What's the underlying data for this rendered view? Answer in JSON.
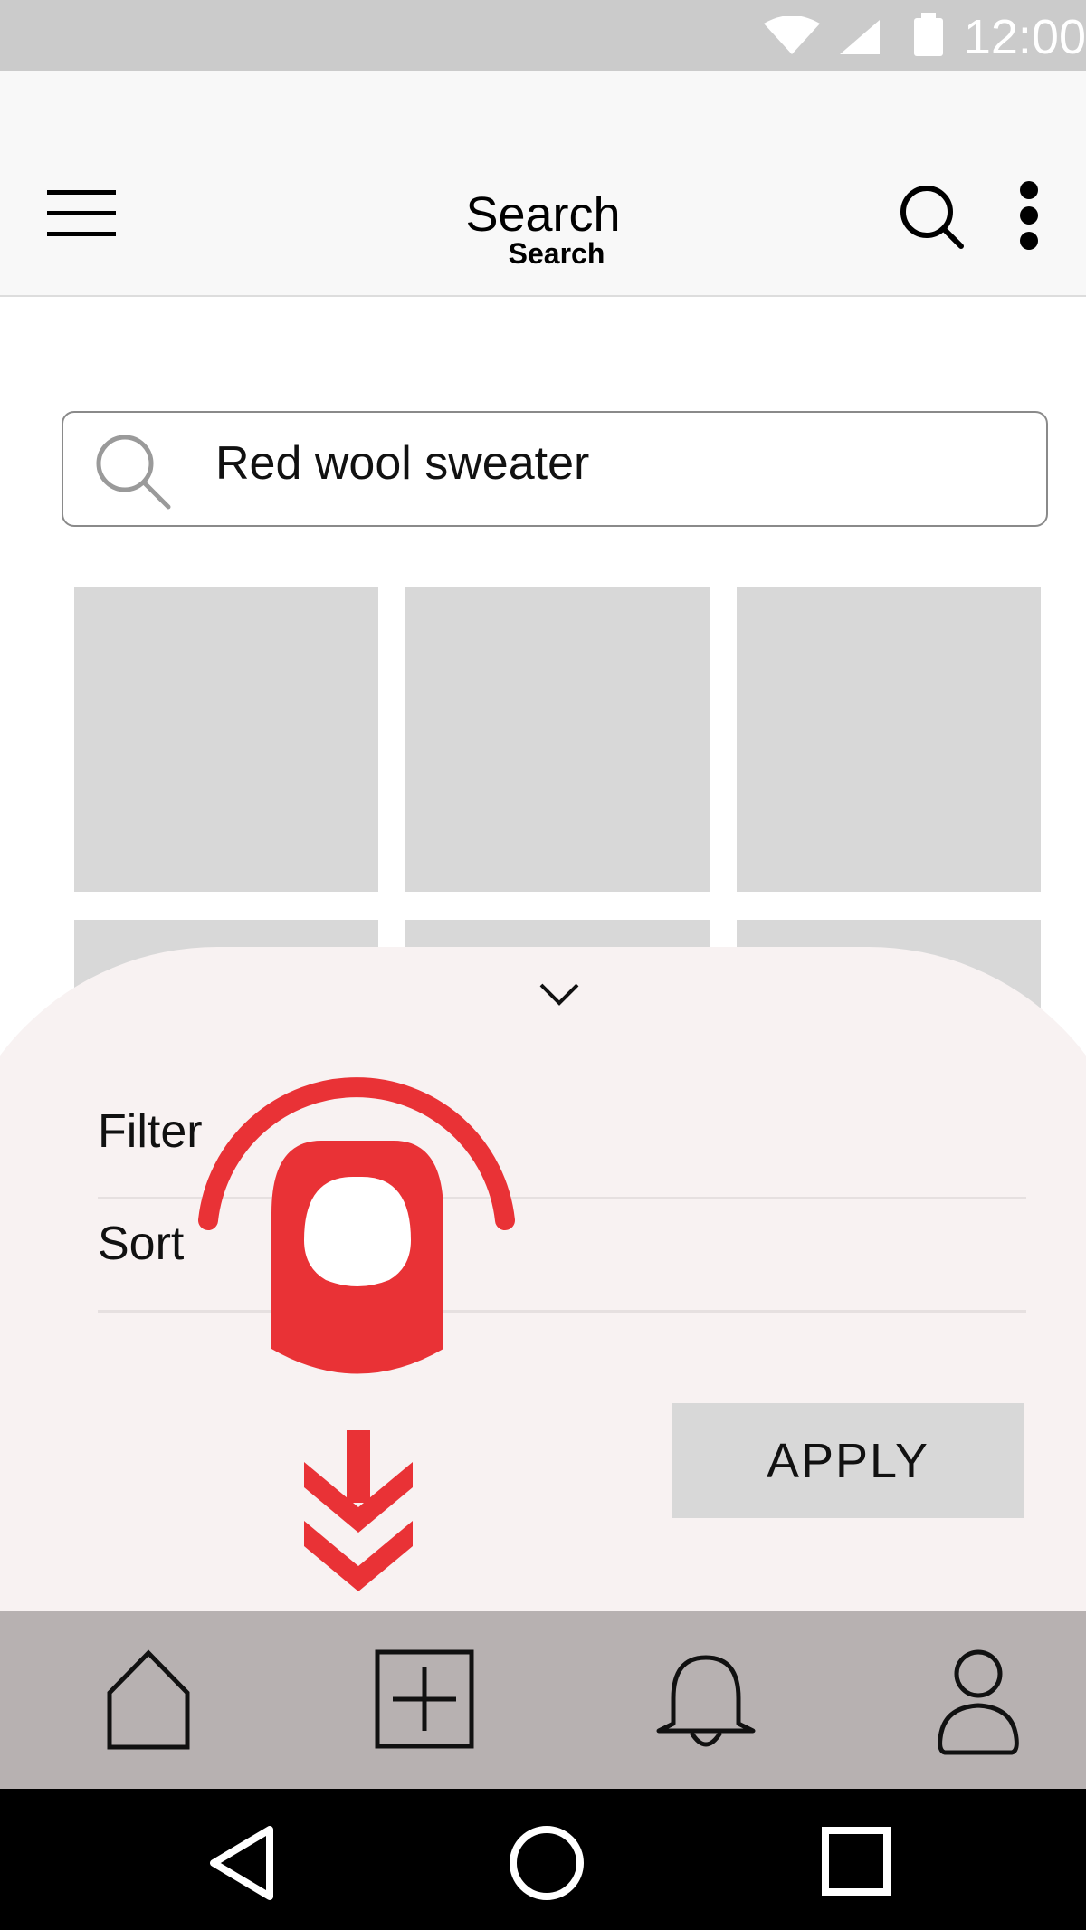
{
  "status_bar": {
    "time": "12:00",
    "icons": [
      "wifi-icon",
      "signal-icon",
      "battery-icon"
    ]
  },
  "app_bar": {
    "title": "Search",
    "subtitle": "Search",
    "left_icon": "menu-icon",
    "right_icons": [
      "search-icon",
      "more-vert-icon"
    ]
  },
  "search": {
    "value": "Red wool sweater",
    "icon": "search-icon"
  },
  "results": {
    "tile_count": 9
  },
  "sheet": {
    "collapse_icon": "chevron-down-icon",
    "rows": [
      {
        "label": "Filter"
      },
      {
        "label": "Sort"
      }
    ],
    "apply_label": "APPLY",
    "gesture_hint": {
      "icon": "swipe-down-gesture-icon",
      "color": "#E93236"
    }
  },
  "bottom_nav": {
    "items": [
      "home-icon",
      "add-box-icon",
      "notifications-icon",
      "profile-icon"
    ]
  },
  "system_nav": {
    "items": [
      "back-icon",
      "home-circle-icon",
      "recents-icon"
    ]
  },
  "colors": {
    "accent": "#E93236",
    "sheet_bg": "#F8F2F2",
    "nav_bg": "#B7B1B1",
    "tile": "#D8D8D8"
  }
}
